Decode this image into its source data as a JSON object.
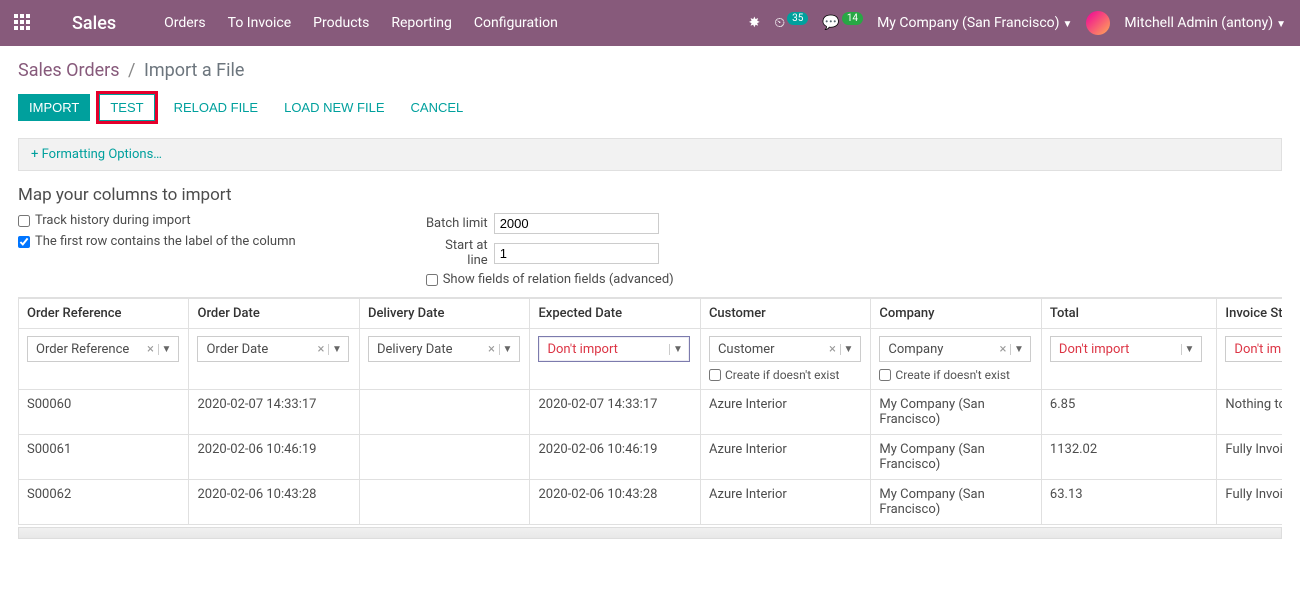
{
  "navbar": {
    "brand": "Sales",
    "links": [
      "Orders",
      "To Invoice",
      "Products",
      "Reporting",
      "Configuration"
    ],
    "clock_badge": "35",
    "chat_badge": "14",
    "company": "My Company (San Francisco)",
    "user": "Mitchell Admin (antony)"
  },
  "breadcrumb": {
    "root": "Sales Orders",
    "current": "Import a File"
  },
  "buttons": {
    "import": "Import",
    "test": "Test",
    "reload": "Reload File",
    "load": "Load New File",
    "cancel": "Cancel"
  },
  "formatting": "+ Formatting Options…",
  "section_title": "Map your columns to import",
  "opts": {
    "track": "Track history during import",
    "firstrow": "The first row contains the label of the column",
    "batch_label": "Batch limit",
    "batch_value": "2000",
    "start_label": "Start at line",
    "start_value": "1",
    "show_rel": "Show fields of relation fields (advanced)"
  },
  "columns": [
    {
      "header": "Order Reference",
      "map": "Order Reference",
      "clearable": true
    },
    {
      "header": "Order Date",
      "map": "Order Date",
      "clearable": true
    },
    {
      "header": "Delivery Date",
      "map": "Delivery Date",
      "clearable": true
    },
    {
      "header": "Expected Date",
      "map": "Don't import",
      "red": true,
      "active": true
    },
    {
      "header": "Customer",
      "map": "Customer",
      "clearable": true,
      "create": true
    },
    {
      "header": "Company",
      "map": "Company",
      "clearable": true,
      "create": true
    },
    {
      "header": "Total",
      "map": "Don't import",
      "red": true
    },
    {
      "header": "Invoice Status",
      "map": "Don't import",
      "red": true
    }
  ],
  "create_label": "Create if doesn't exist",
  "rows": [
    {
      "c": [
        "S00060",
        "2020-02-07 14:33:17",
        "",
        "2020-02-07 14:33:17",
        "Azure Interior",
        "My Company (San Francisco)",
        "6.85",
        "Nothing to Invoice"
      ]
    },
    {
      "c": [
        "S00061",
        "2020-02-06 10:46:19",
        "",
        "2020-02-06 10:46:19",
        "Azure Interior",
        "My Company (San Francisco)",
        "1132.02",
        "Fully Invoiced"
      ]
    },
    {
      "c": [
        "S00062",
        "2020-02-06 10:43:28",
        "",
        "2020-02-06 10:43:28",
        "Azure Interior",
        "My Company (San Francisco)",
        "63.13",
        "Fully Invoiced"
      ]
    }
  ]
}
